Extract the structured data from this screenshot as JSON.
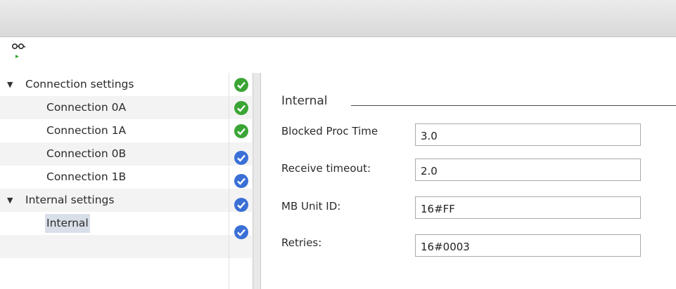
{
  "toolbar": {
    "icon": "connection-glasses-icon"
  },
  "tree": {
    "groups": [
      {
        "label": "Connection settings",
        "status": "ok",
        "children": [
          {
            "label": "Connection 0A",
            "status": "ok"
          },
          {
            "label": "Connection 1A",
            "status": "ok"
          },
          {
            "label": "Connection 0B",
            "status": "info"
          },
          {
            "label": "Connection 1B",
            "status": "info"
          }
        ]
      },
      {
        "label": "Internal settings",
        "status": "info",
        "children": [
          {
            "label": "Internal",
            "status": "info",
            "selected": true
          }
        ]
      }
    ]
  },
  "colors": {
    "ok": "#3aa535",
    "info": "#3a6fd6"
  },
  "panel": {
    "title": "Internal",
    "fields": [
      {
        "label": "Blocked Proc Time",
        "value": "3.0"
      },
      {
        "label": "Receive timeout:",
        "value": "2.0"
      },
      {
        "label": "MB Unit ID:",
        "value": "16#FF"
      },
      {
        "label": "Retries:",
        "value": "16#0003"
      }
    ]
  }
}
